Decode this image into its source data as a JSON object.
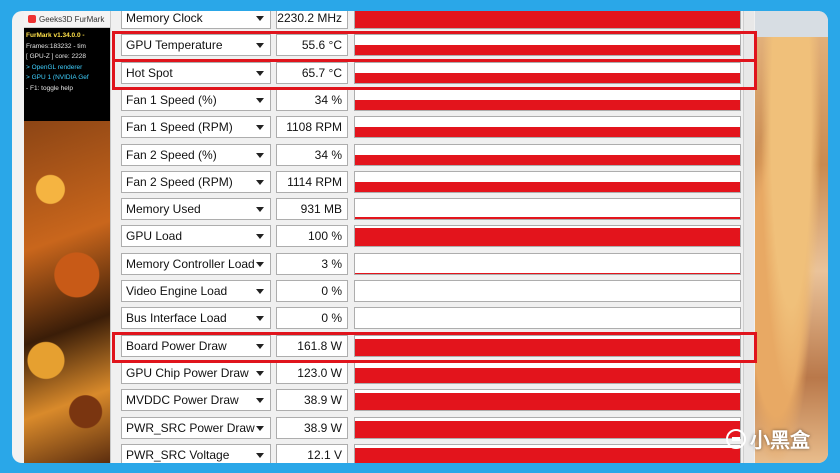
{
  "colors": {
    "accent_frame": "#2aa7e8",
    "graph_fill": "#e3141c",
    "highlight": "#e0141c"
  },
  "furmark": {
    "title": "Geeks3D FurMark",
    "lines": [
      {
        "text": "FurMark v1.34.0.0 -",
        "style": "yellow"
      },
      {
        "text": "Frames:183232 - tim",
        "style": "white"
      },
      {
        "text": "[ GPU-Z ] core: 2228",
        "style": "white"
      },
      {
        "text": "> OpenGL renderer",
        "style": "cyan"
      },
      {
        "text": "> GPU 1 (NVIDIA Gef",
        "style": "cyan"
      },
      {
        "text": "- F1: toggle help",
        "style": "white"
      }
    ]
  },
  "sensors": [
    {
      "name": "Memory Clock",
      "value": "2230.2 MHz",
      "level": 0.96
    },
    {
      "name": "GPU Temperature",
      "value": "55.6 °C",
      "level": 0.5
    },
    {
      "name": "Hot Spot",
      "value": "65.7 °C",
      "level": 0.5
    },
    {
      "name": "Fan 1 Speed (%)",
      "value": "34 %",
      "level": 0.5
    },
    {
      "name": "Fan 1 Speed (RPM)",
      "value": "1108 RPM",
      "level": 0.5
    },
    {
      "name": "Fan 2 Speed (%)",
      "value": "34 %",
      "level": 0.5
    },
    {
      "name": "Fan 2 Speed (RPM)",
      "value": "1114 RPM",
      "level": 0.5
    },
    {
      "name": "Memory Used",
      "value": "931 MB",
      "level": 0.1
    },
    {
      "name": "GPU Load",
      "value": "100 %",
      "level": 0.9
    },
    {
      "name": "Memory Controller Load",
      "value": "3 %",
      "level": 0.05
    },
    {
      "name": "Video Engine Load",
      "value": "0 %",
      "level": 0.0
    },
    {
      "name": "Bus Interface Load",
      "value": "0 %",
      "level": 0.0
    },
    {
      "name": "Board Power Draw",
      "value": "161.8 W",
      "level": 0.85
    },
    {
      "name": "GPU Chip Power Draw",
      "value": "123.0 W",
      "level": 0.75
    },
    {
      "name": "MVDDC Power Draw",
      "value": "38.9 W",
      "level": 0.85
    },
    {
      "name": "PWR_SRC Power Draw",
      "value": "38.9 W",
      "level": 0.85
    },
    {
      "name": "PWR_SRC Voltage",
      "value": "12.1 V",
      "level": 0.85
    }
  ],
  "highlighted": [
    "GPU Temperature",
    "Hot Spot",
    "Board Power Draw"
  ],
  "watermark": {
    "text": "小黑盒",
    "icon": "heybox-logo-icon"
  }
}
